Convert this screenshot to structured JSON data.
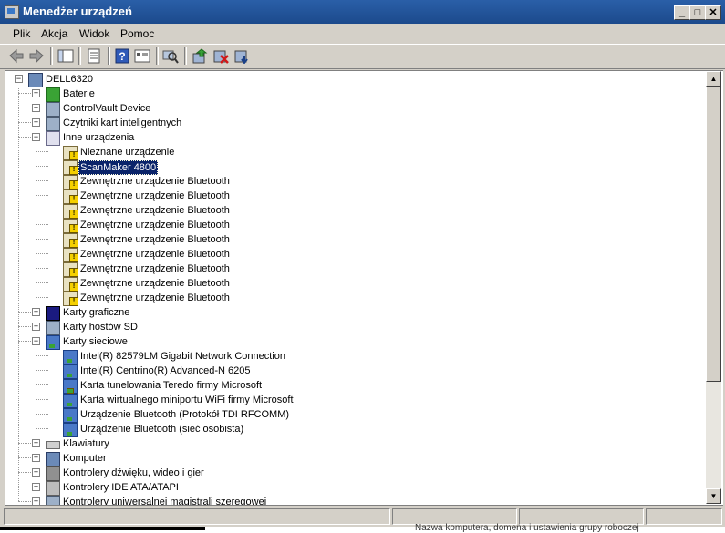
{
  "window": {
    "title": "Menedżer urządzeń",
    "minimize": "_",
    "maximize": "□",
    "close": "✕"
  },
  "menu": [
    "Plik",
    "Akcja",
    "Widok",
    "Pomoc"
  ],
  "toolbar": [
    "back-icon",
    "forward-icon",
    "show-hide-tree-icon",
    "properties-icon",
    "help-icon",
    "view-icon",
    "scan-hardware-icon",
    "update-driver-icon",
    "disable-device-icon",
    "uninstall-device-icon"
  ],
  "tree": {
    "root": "DELL6320",
    "nodes": [
      {
        "label": "Baterie",
        "expander": "+",
        "icon": "battery-icon"
      },
      {
        "label": "ControlVault Device",
        "expander": "+",
        "icon": "device-icon"
      },
      {
        "label": "Czytniki kart inteligentnych",
        "expander": "+",
        "icon": "smartcard-reader-icon"
      },
      {
        "label": "Inne urządzenia",
        "expander": "-",
        "icon": "unknown-device-icon",
        "children": [
          "Nieznane urządzenie",
          "ScanMaker 4800",
          "Zewnętrzne urządzenie Bluetooth",
          "Zewnętrzne urządzenie Bluetooth",
          "Zewnętrzne urządzenie Bluetooth",
          "Zewnętrzne urządzenie Bluetooth",
          "Zewnętrzne urządzenie Bluetooth",
          "Zewnętrzne urządzenie Bluetooth",
          "Zewnętrzne urządzenie Bluetooth",
          "Zewnętrzne urządzenie Bluetooth",
          "Zewnętrzne urządzenie Bluetooth"
        ],
        "selected_child": "ScanMaker 4800"
      },
      {
        "label": "Karty graficzne",
        "expander": "+",
        "icon": "display-adapter-icon"
      },
      {
        "label": "Karty hostów SD",
        "expander": "+",
        "icon": "sd-host-icon"
      },
      {
        "label": "Karty sieciowe",
        "expander": "-",
        "icon": "network-adapter-icon",
        "children": [
          "Intel(R) 82579LM Gigabit Network Connection",
          "Intel(R) Centrino(R) Advanced-N 6205",
          "Karta tunelowania Teredo firmy Microsoft",
          "Karta wirtualnego miniportu WiFi firmy Microsoft",
          "Urządzenie Bluetooth (Protokół TDI RFCOMM)",
          "Urządzenie Bluetooth (sieć osobista)"
        ],
        "warning_children": [
          2
        ]
      },
      {
        "label": "Klawiatury",
        "expander": "+",
        "icon": "keyboard-icon"
      },
      {
        "label": "Komputer",
        "expander": "+",
        "icon": "computer-icon"
      },
      {
        "label": "Kontrolery dźwięku, wideo i gier",
        "expander": "+",
        "icon": "sound-icon"
      },
      {
        "label": "Kontrolery IDE ATA/ATAPI",
        "expander": "+",
        "icon": "ide-icon"
      },
      {
        "label": "Kontrolery uniwersalnej magistrali szeregowej",
        "expander": "+",
        "icon": "usb-icon"
      }
    ]
  },
  "bottom_caption": "Nazwa komputera, domena i ustawienia grupy roboczej",
  "colors": {
    "selection": "#0a246a",
    "titlebar": "#1c4a8c",
    "chrome": "#d4d0c8",
    "warning": "#f5d000"
  }
}
